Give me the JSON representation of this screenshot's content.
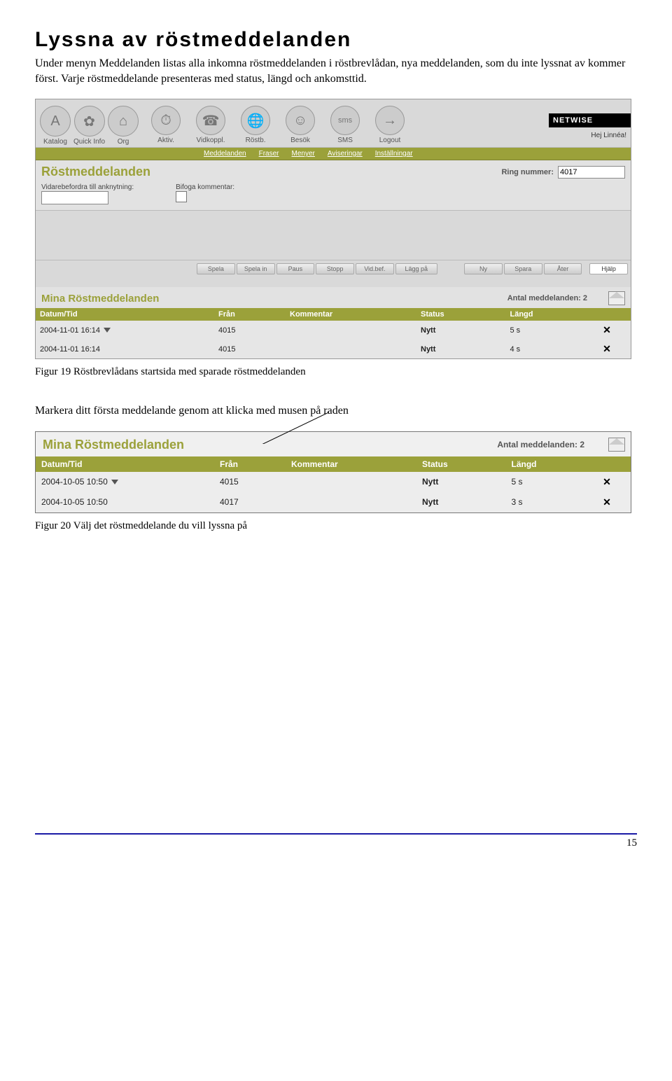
{
  "heading": "Lyssna av röstmeddelanden",
  "intro": "Under menyn Meddelanden listas alla inkomna röstmeddelanden i röstbrevlådan, nya meddelanden, som du inte lyssnat av kommer först. Varje röstmeddelande presenteras med status, längd och ankomsttid.",
  "fig1_caption": "Figur 19  Röstbrevlådans startsida med sparade röstmeddelanden",
  "mid_text": "Markera ditt första meddelande genom att klicka med musen på raden",
  "fig2_caption": "Figur 20  Välj det röstmeddelande du vill lyssna på",
  "page_number": "15",
  "app": {
    "top_items_left": [
      {
        "label": "Katalog",
        "icon": "A"
      },
      {
        "label": "Quick Info",
        "icon": "✿"
      },
      {
        "label": "Org",
        "icon": "⌂"
      }
    ],
    "top_items_right": [
      {
        "label": "Aktiv.",
        "icon": "⏱"
      },
      {
        "label": "Vidkoppl.",
        "icon": "☎"
      },
      {
        "label": "Röstb.",
        "icon": "🌐"
      },
      {
        "label": "Besök",
        "icon": "☺"
      },
      {
        "label": "SMS",
        "icon": "sms"
      },
      {
        "label": "Logout",
        "icon": "→"
      }
    ],
    "brand": "NETWISE",
    "greeting": "Hej Linnéa!",
    "subnav": [
      "Meddelanden",
      "Fraser",
      "Menyer",
      "Aviseringar",
      "Inställningar"
    ],
    "section_title": "Röstmeddelanden",
    "ring_label": "Ring nummer:",
    "ring_value": "4017",
    "forward_label": "Vidarebefordra till anknytning:",
    "attach_label": "Bifoga kommentar:",
    "buttons": [
      "Spela",
      "Spela in",
      "Paus",
      "Stopp",
      "Vid.bef.",
      "Lägg på"
    ],
    "buttons_right": [
      "Ny",
      "Spara",
      "Åter"
    ],
    "help_button": "Hjälp",
    "mina_title": "Mina Röstmeddelanden",
    "antal_label": "Antal meddelanden: 2",
    "columns": [
      "Datum/Tid",
      "Från",
      "Kommentar",
      "Status",
      "Längd"
    ],
    "rows": [
      {
        "datetime": "2004-11-01 16:14",
        "from": "4015",
        "comment": "",
        "status": "Nytt",
        "length": "5 s"
      },
      {
        "datetime": "2004-11-01 16:14",
        "from": "4015",
        "comment": "",
        "status": "Nytt",
        "length": "4 s"
      }
    ]
  },
  "panel2": {
    "mina_title": "Mina Röstmeddelanden",
    "antal_label": "Antal meddelanden: 2",
    "columns": [
      "Datum/Tid",
      "Från",
      "Kommentar",
      "Status",
      "Längd"
    ],
    "rows": [
      {
        "datetime": "2004-10-05 10:50",
        "from": "4015",
        "comment": "",
        "status": "Nytt",
        "length": "5 s"
      },
      {
        "datetime": "2004-10-05 10:50",
        "from": "4017",
        "comment": "",
        "status": "Nytt",
        "length": "3 s"
      }
    ]
  }
}
